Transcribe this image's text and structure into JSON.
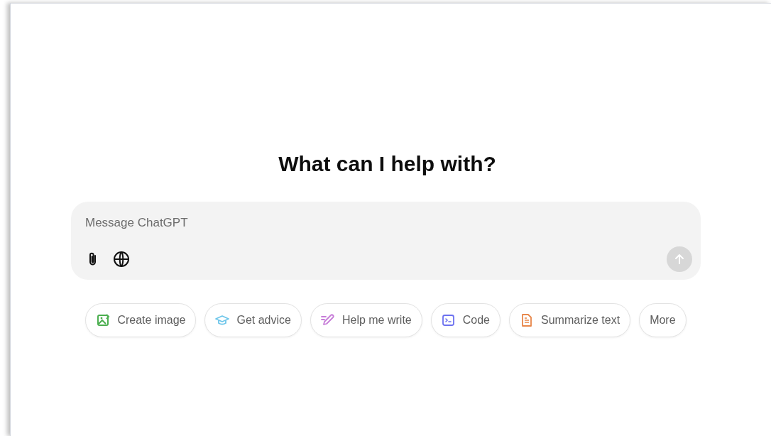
{
  "heading": "What can I help with?",
  "composer": {
    "placeholder": "Message ChatGPT",
    "send_disabled": true
  },
  "suggestions": [
    {
      "kind": "image",
      "label": "Create image"
    },
    {
      "kind": "advice",
      "label": "Get advice"
    },
    {
      "kind": "write",
      "label": "Help me write"
    },
    {
      "kind": "code",
      "label": "Code"
    },
    {
      "kind": "summarize",
      "label": "Summarize text"
    },
    {
      "kind": "more",
      "label": "More"
    }
  ]
}
